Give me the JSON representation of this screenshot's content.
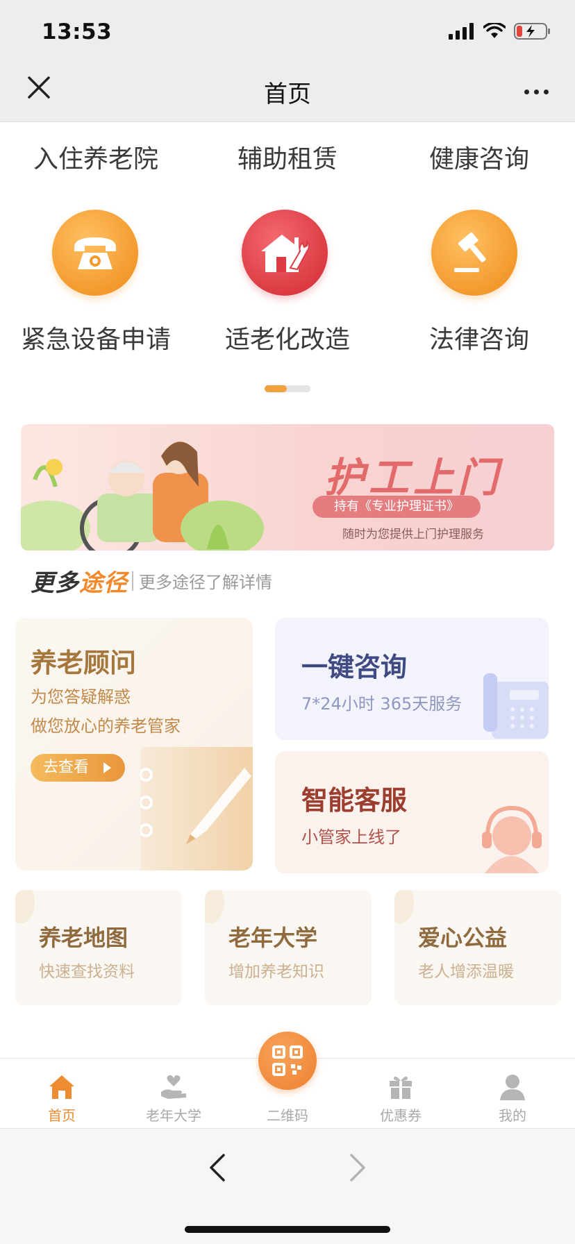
{
  "status_bar": {
    "time": "13:53"
  },
  "nav": {
    "title": "首页"
  },
  "grid": {
    "row1": [
      "入住养老院",
      "辅助租赁",
      "健康咨询"
    ],
    "items": [
      {
        "label": "紧急设备申请",
        "icon": "telephone-icon",
        "color": "#f39a2e"
      },
      {
        "label": "适老化改造",
        "icon": "house-wrench-icon",
        "color": "#dc3b43"
      },
      {
        "label": "法律咨询",
        "icon": "gavel-icon",
        "color": "#f39a2e"
      }
    ]
  },
  "banner": {
    "title": "护工上门",
    "pill": "持有《专业护理证书》",
    "subtitle": "随时为您提供上门护理服务"
  },
  "more_ways": {
    "logo_part1": "更多",
    "logo_part2": "途径",
    "text": "更多途径了解详情"
  },
  "cards": {
    "advisor": {
      "title": "养老顾问",
      "line1": "为您答疑解惑",
      "line2": "做您放心的养老管家",
      "button": "去查看"
    },
    "consult": {
      "title": "一键咨询",
      "subtitle": "7*24小时 365天服务"
    },
    "service": {
      "title": "智能客服",
      "subtitle": "小管家上线了"
    }
  },
  "small_cards": [
    {
      "title": "养老地图",
      "subtitle": "快速查找资料"
    },
    {
      "title": "老年大学",
      "subtitle": "增加养老知识"
    },
    {
      "title": "爱心公益",
      "subtitle": "老人增添温暖"
    }
  ],
  "tabbar": {
    "home": "首页",
    "university": "老年大学",
    "qrcode": "二维码",
    "coupon": "优惠券",
    "mine": "我的",
    "active_color": "#ee8c32"
  }
}
